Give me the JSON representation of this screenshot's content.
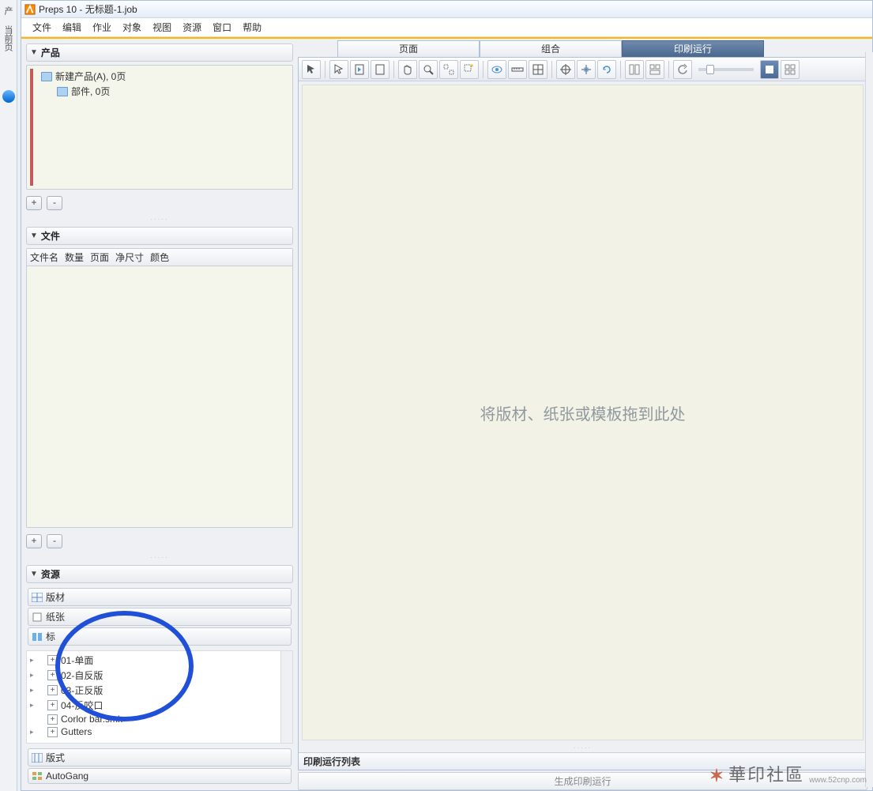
{
  "edge": {
    "tab1": "产",
    "tab2": "当前页"
  },
  "title_bar": {
    "title": "Preps 10 - 无标题-1.job"
  },
  "menu": [
    "文件",
    "编辑",
    "作业",
    "对象",
    "视图",
    "资源",
    "窗口",
    "帮助"
  ],
  "sections": {
    "product": "产品",
    "files": "文件",
    "resources": "资源"
  },
  "product_tree": {
    "root": "新建产品(A), 0页",
    "child": "部件, 0页"
  },
  "buttons": {
    "plus": "+",
    "minus": "-"
  },
  "file_headers": [
    "文件名",
    "数量",
    "页面",
    "净尺寸",
    "颜色"
  ],
  "res_tabs": {
    "stock": "版材",
    "paper": "纸张",
    "mark_short": "标",
    "layout": "版式",
    "autogang": "AutoGang"
  },
  "resource_tree": [
    "01-单面",
    "02-自反版",
    "03-正反版",
    "04-反咬口",
    "Corlor bar.smk",
    "Gutters"
  ],
  "main_tabs": {
    "pages": "页面",
    "combo": "组合",
    "pressrun": "印刷运行"
  },
  "canvas_hint": "将版材、纸张或模板拖到此处",
  "bottom": {
    "pressrun_list": "印刷运行列表",
    "generate": "生成印刷运行"
  },
  "watermark": {
    "brand": "華印社區",
    "url": "www.52cnp.com"
  }
}
